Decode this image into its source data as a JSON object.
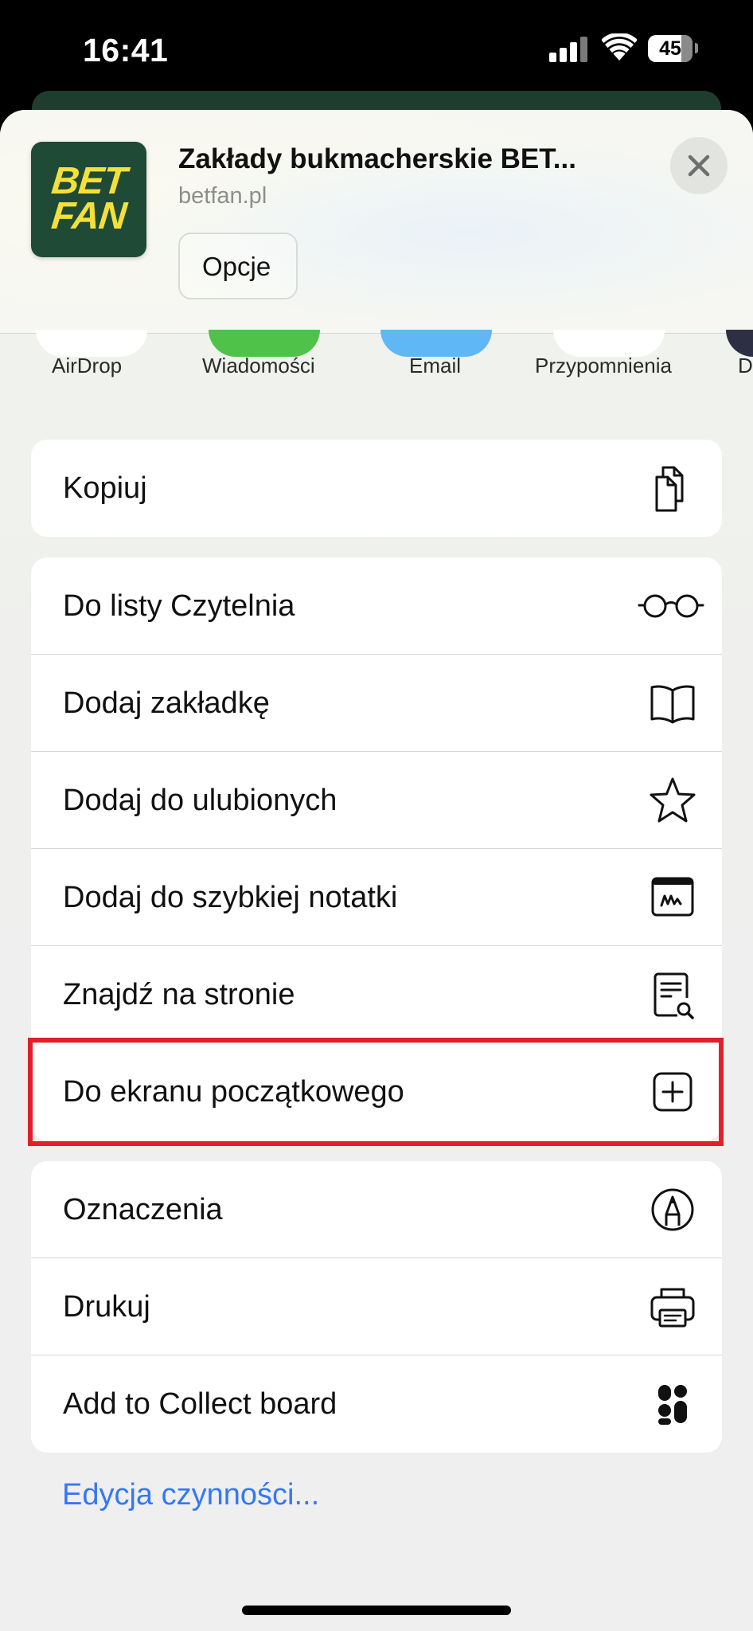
{
  "status_bar": {
    "time": "16:41",
    "battery_level": "45",
    "icons": [
      "signal-icon",
      "wifi-icon",
      "battery-icon"
    ]
  },
  "share_header": {
    "app_icon_text": [
      "BET",
      "FAN"
    ],
    "title": "Zakłady bukmacherskie BET...",
    "url": "betfan.pl",
    "options_label": "Opcje",
    "close_icon": "close-icon"
  },
  "share_targets": [
    {
      "label": "AirDrop",
      "color": "#ffffff"
    },
    {
      "label": "Wiadomości",
      "color": "#4fc24a"
    },
    {
      "label": "Email",
      "color": "#5fb8f5"
    },
    {
      "label": "Przypomnienia",
      "color": "#ffffff"
    },
    {
      "label": "D",
      "color": "#2d2f45"
    }
  ],
  "actions": {
    "group1": [
      {
        "label": "Kopiuj",
        "icon": "copy-icon"
      }
    ],
    "group2": [
      {
        "label": "Do listy Czytelnia",
        "icon": "glasses-icon"
      },
      {
        "label": "Dodaj zakładkę",
        "icon": "book-icon"
      },
      {
        "label": "Dodaj do ulubionych",
        "icon": "star-icon"
      },
      {
        "label": "Dodaj do szybkiej notatki",
        "icon": "quick-note-icon"
      },
      {
        "label": "Znajdź na stronie",
        "icon": "find-on-page-icon"
      },
      {
        "label": "Do ekranu początkowego",
        "icon": "add-square-icon",
        "highlighted": true
      }
    ],
    "group3": [
      {
        "label": "Oznaczenia",
        "icon": "markup-icon"
      },
      {
        "label": "Drukuj",
        "icon": "printer-icon"
      },
      {
        "label": "Add to Collect board",
        "icon": "collect-icon"
      }
    ]
  },
  "edit_actions_label": "Edycja czynności...",
  "colors": {
    "accent": "#3478f6",
    "highlight_border": "#e3202a",
    "app_icon_bg": "#1e4a36",
    "app_icon_text": "#f3e03a"
  }
}
